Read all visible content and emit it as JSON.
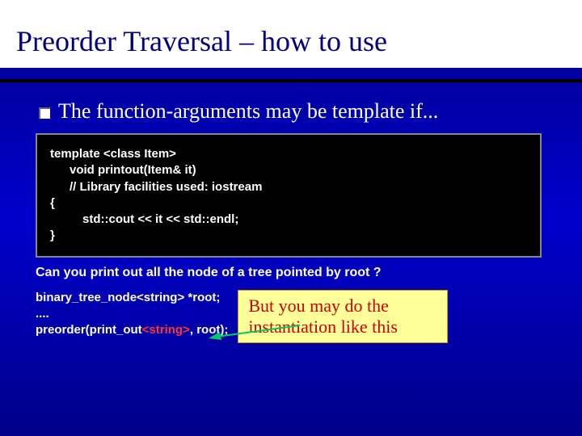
{
  "slide": {
    "title": "Preorder Traversal – how to use",
    "bullet": "The function-arguments may be template if...",
    "code": {
      "l1": "template <class Item>",
      "l2": "void printout(Item& it)",
      "l3": "// Library facilities used: iostream",
      "l4": "{",
      "l5": "std::cout <<  it << std::endl;",
      "l6": "}"
    },
    "question": "Can you print out all the node of a tree pointed by root ?",
    "snippet": {
      "l1": "binary_tree_node<string> *root;",
      "l2": "....",
      "l3a": "preorder(print_out",
      "l3b": "<string>",
      "l3c": ", root);"
    },
    "callout": "But you may do the instantiation like this"
  }
}
